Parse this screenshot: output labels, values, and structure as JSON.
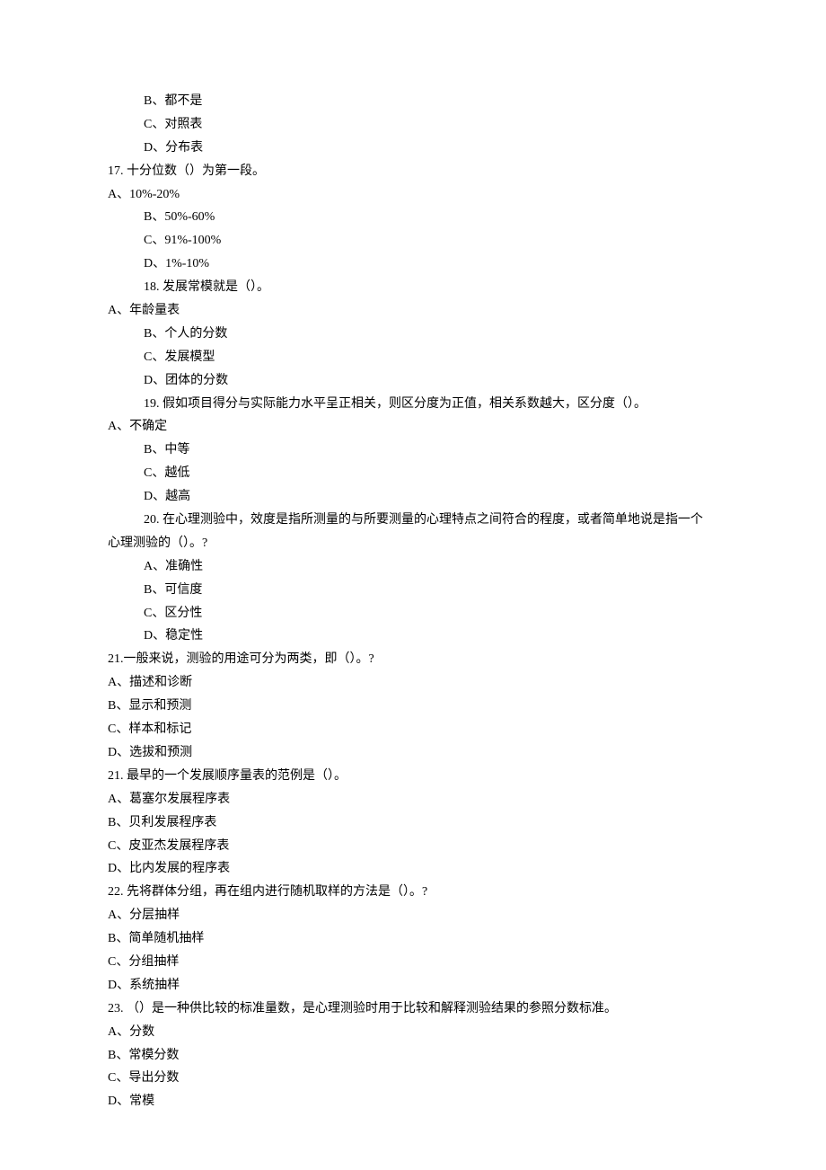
{
  "lines": [
    {
      "indent": 1,
      "text": "B、都不是"
    },
    {
      "indent": 1,
      "text": "C、对照表"
    },
    {
      "indent": 1,
      "text": "D、分布表"
    },
    {
      "indent": 0,
      "text": "17.  十分位数（）为第一段。"
    },
    {
      "indent": 0,
      "text": "A、10%-20%"
    },
    {
      "indent": 1,
      "text": "B、50%-60%"
    },
    {
      "indent": 1,
      "text": "C、91%-100%"
    },
    {
      "indent": 1,
      "text": "D、1%-10%"
    },
    {
      "indent": 1,
      "text": "18.  发展常模就是（）。"
    },
    {
      "indent": 0,
      "text": "A、年龄量表"
    },
    {
      "indent": 1,
      "text": "B、个人的分数"
    },
    {
      "indent": 1,
      "text": "C、发展模型"
    },
    {
      "indent": 1,
      "text": "D、团体的分数"
    },
    {
      "indent": 1,
      "text": "19.  假如项目得分与实际能力水平呈正相关，则区分度为正值，相关系数越大，区分度（）。"
    },
    {
      "indent": 0,
      "text": "A、不确定"
    },
    {
      "indent": 1,
      "text": "B、中等"
    },
    {
      "indent": 1,
      "text": "C、越低"
    },
    {
      "indent": 1,
      "text": "D、越高"
    },
    {
      "indent": 1,
      "text": "20.  在心理测验中，效度是指所测量的与所要测量的心理特点之间符合的程度，或者简单地说是指一个"
    },
    {
      "indent": 0,
      "text": "心理测验的（）。?"
    },
    {
      "indent": 1,
      "text": "A、准确性"
    },
    {
      "indent": 1,
      "text": "B、可信度"
    },
    {
      "indent": 1,
      "text": "C、区分性"
    },
    {
      "indent": 1,
      "text": "D、稳定性"
    },
    {
      "indent": 0,
      "text": "21.一般来说，测验的用途可分为两类，即（）。?"
    },
    {
      "indent": 0,
      "text": "A、描述和诊断"
    },
    {
      "indent": 0,
      "text": "B、显示和预测"
    },
    {
      "indent": 0,
      "text": "C、样本和标记"
    },
    {
      "indent": 0,
      "text": "D、选拔和预测"
    },
    {
      "indent": 0,
      "text": "21.  最早的一个发展顺序量表的范例是（）。"
    },
    {
      "indent": 0,
      "text": "A、葛塞尔发展程序表"
    },
    {
      "indent": 0,
      "text": "B、贝利发展程序表"
    },
    {
      "indent": 0,
      "text": "C、皮亚杰发展程序表"
    },
    {
      "indent": 0,
      "text": "D、比内发展的程序表"
    },
    {
      "indent": 0,
      "text": "22.  先将群体分组，再在组内进行随机取样的方法是（）。?"
    },
    {
      "indent": 0,
      "text": "A、分层抽样"
    },
    {
      "indent": 0,
      "text": "B、简单随机抽样"
    },
    {
      "indent": 0,
      "text": "C、分组抽样"
    },
    {
      "indent": 0,
      "text": "D、系统抽样"
    },
    {
      "indent": 0,
      "text": "23.  （）是一种供比较的标准量数，是心理测验时用于比较和解释测验结果的参照分数标准。"
    },
    {
      "indent": 0,
      "text": "A、分数"
    },
    {
      "indent": 0,
      "text": "B、常模分数"
    },
    {
      "indent": 0,
      "text": "C、导出分数"
    },
    {
      "indent": 0,
      "text": "D、常模"
    }
  ]
}
